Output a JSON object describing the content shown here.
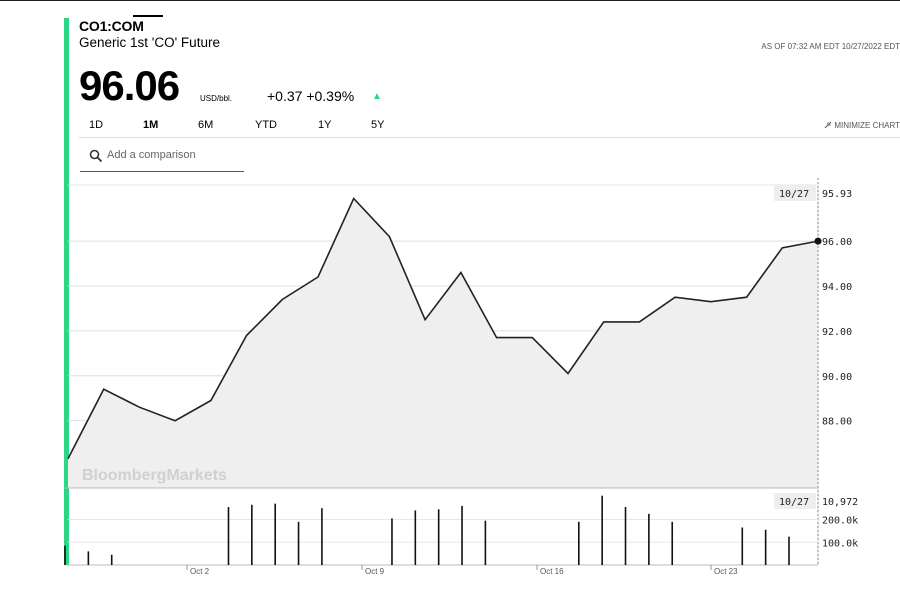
{
  "header": {
    "ticker": "CO1:COM",
    "name": "Generic 1st 'CO' Future",
    "as_of": "AS OF 07:32 AM EDT 10/27/2022 EDT",
    "price": "96.06",
    "unit": "USD/bbl.",
    "change": "+0.37 +0.39%",
    "change_arrow": "▲",
    "change_color": "#2bd784"
  },
  "tabs": [
    {
      "label": "1D"
    },
    {
      "label": "1M"
    },
    {
      "label": "6M"
    },
    {
      "label": "YTD"
    },
    {
      "label": "1Y"
    },
    {
      "label": "5Y"
    }
  ],
  "active_tab": "1M",
  "minimize": {
    "label": "MINIMIZE CHART"
  },
  "compare": {
    "placeholder": "Add a comparison"
  },
  "watermark": "BloombergMarkets",
  "chart_data": {
    "type": "line",
    "x": [
      "Sep 28",
      "Sep 29",
      "Sep 30",
      "Oct 3",
      "Oct 4",
      "Oct 5",
      "Oct 6",
      "Oct 7",
      "Oct 10",
      "Oct 11",
      "Oct 12",
      "Oct 13",
      "Oct 14",
      "Oct 17",
      "Oct 18",
      "Oct 19",
      "Oct 20",
      "Oct 21",
      "Oct 24",
      "Oct 25",
      "Oct 26",
      "Oct 27"
    ],
    "values": [
      86.3,
      89.4,
      88.6,
      88.0,
      88.9,
      91.8,
      93.4,
      94.4,
      97.9,
      96.2,
      92.5,
      94.6,
      91.7,
      91.7,
      90.1,
      92.4,
      92.4,
      93.5,
      93.3,
      93.5,
      95.7,
      96.0
    ],
    "ylim": [
      85.0,
      98.5
    ],
    "yticks": [
      "88.00",
      "90.00",
      "92.00",
      "94.00",
      "96.00"
    ],
    "ytick_values": [
      88,
      90,
      92,
      94,
      96
    ],
    "xticks": [
      "Oct 2",
      "Oct 9",
      "Oct 16",
      "Oct 23"
    ],
    "cursor_label": {
      "date": "10/27",
      "value": "95.93"
    },
    "line_color": "#222222",
    "area_color": "#efefef",
    "grid": true
  },
  "volume_data": {
    "type": "bar",
    "values_k": [
      85,
      60,
      45,
      0,
      0,
      0,
      0,
      255,
      265,
      270,
      190,
      250,
      0,
      0,
      205,
      240,
      245,
      260,
      195,
      0,
      0,
      0,
      190,
      305,
      255,
      225,
      190,
      0,
      0,
      165,
      155,
      125
    ],
    "ylim": [
      0,
      330
    ],
    "yticks": [
      "100.0k",
      "200.0k"
    ],
    "ytick_values": [
      100,
      200
    ],
    "cursor_label": {
      "date": "10/27",
      "value": "10,972"
    }
  }
}
